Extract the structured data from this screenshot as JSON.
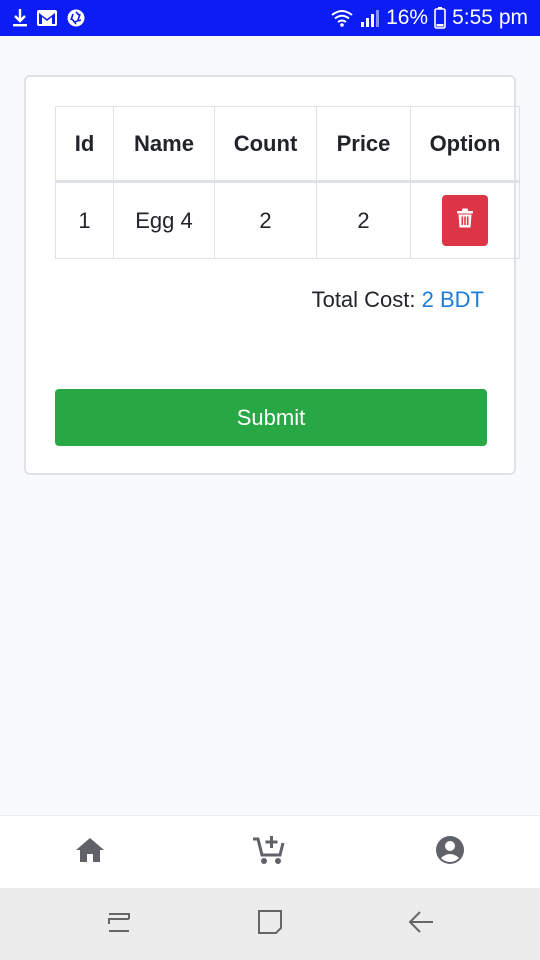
{
  "status_bar": {
    "battery_percent": "16%",
    "time": "5:55 pm",
    "left_icons": [
      "download-icon",
      "gmail-icon",
      "camera-shutter-icon"
    ],
    "right_icons": [
      "wifi-icon",
      "signal-icon",
      "battery-icon"
    ],
    "bar_color": "#0b1cf5"
  },
  "cart": {
    "columns": [
      "Id",
      "Name",
      "Count",
      "Price",
      "Option"
    ],
    "rows": [
      {
        "id": "1",
        "name": "Egg 4",
        "count": "2",
        "price": "2",
        "option_icon": "trash-icon"
      }
    ],
    "total_label": "Total Cost:",
    "total_value": "2 BDT",
    "submit_label": "Submit",
    "colors": {
      "submit": "#28a745",
      "delete": "#dc3545",
      "total_value": "#1c7cd6"
    }
  },
  "bottom_nav": {
    "items": [
      {
        "icon": "home-icon"
      },
      {
        "icon": "add-to-cart-icon"
      },
      {
        "icon": "account-icon"
      }
    ]
  },
  "system_nav": {
    "items": [
      "recent-apps-icon",
      "home-square-icon",
      "back-icon"
    ]
  }
}
